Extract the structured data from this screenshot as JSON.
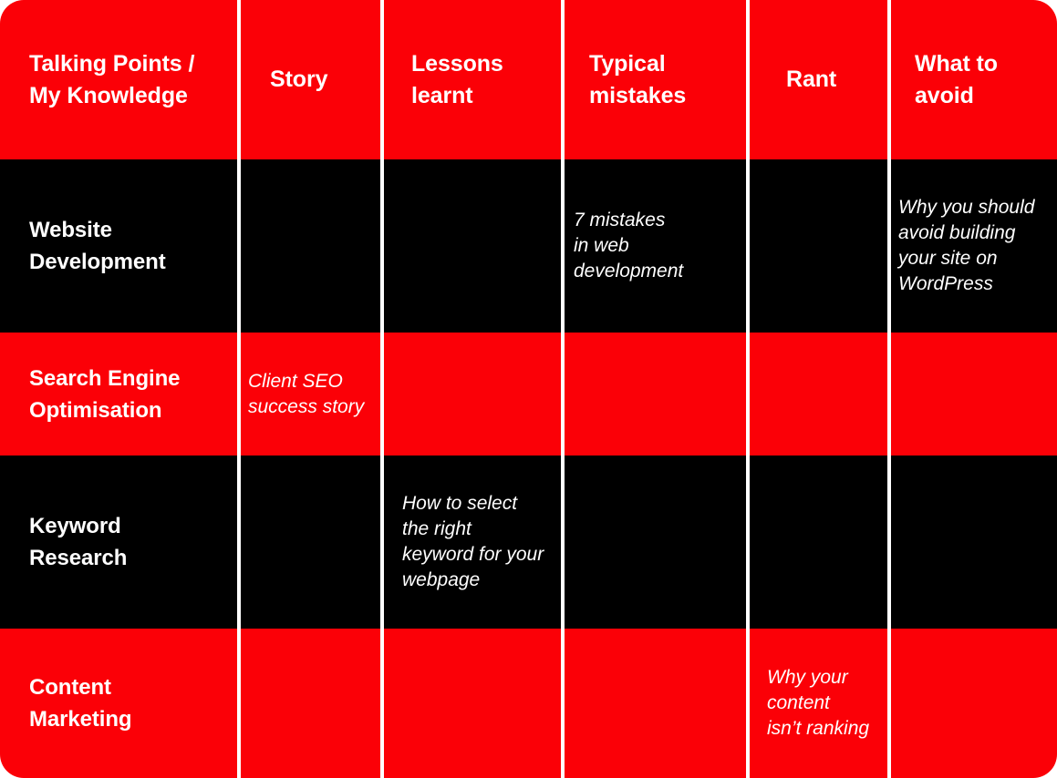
{
  "table": {
    "columns": [
      {
        "id": "topic",
        "label": "Talking Points /\nMy Knowledge"
      },
      {
        "id": "story",
        "label": "Story"
      },
      {
        "id": "lessons",
        "label": "Lessons\nlearnt"
      },
      {
        "id": "mistakes",
        "label": "Typical\nmistakes"
      },
      {
        "id": "rant",
        "label": "Rant"
      },
      {
        "id": "avoid",
        "label": "What to\navoid"
      }
    ],
    "rows": [
      {
        "id": "website-development",
        "label": "Website\nDevelopment",
        "theme": "dark",
        "cells": {
          "story": "",
          "lessons": "",
          "mistakes": "7 mistakes\nin web\ndevelopment",
          "rant": "",
          "avoid": "Why you should\navoid building\nyour site on\nWordPress"
        }
      },
      {
        "id": "search-engine-optimisation",
        "label": "Search Engine\nOptimisation",
        "theme": "red",
        "cells": {
          "story": "Client SEO\nsuccess story",
          "lessons": "",
          "mistakes": "",
          "rant": "",
          "avoid": ""
        }
      },
      {
        "id": "keyword-research",
        "label": "Keyword\nResearch",
        "theme": "dark",
        "cells": {
          "story": "",
          "lessons": "How to select\nthe right\nkeyword for your\nwebpage",
          "mistakes": "",
          "rant": "",
          "avoid": ""
        }
      },
      {
        "id": "content-marketing",
        "label": "Content\nMarketing",
        "theme": "red",
        "cells": {
          "story": "",
          "lessons": "",
          "mistakes": "",
          "rant": "Why your\ncontent\nisn’t ranking",
          "avoid": ""
        }
      }
    ]
  },
  "colors": {
    "red": "#fb0007",
    "dark": "#000000",
    "text": "#ffffff",
    "divider": "#ffffff"
  }
}
